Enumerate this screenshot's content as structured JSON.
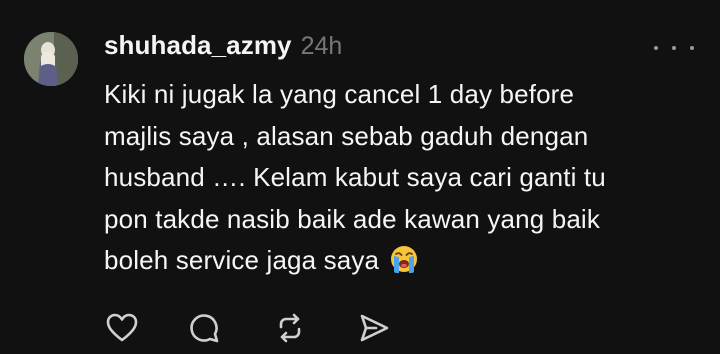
{
  "post": {
    "username": "shuhada_azmy",
    "time": "24h",
    "lines": [
      "Kiki ni jugak la yang cancel 1 day before",
      "majlis saya , alasan sebab gaduh dengan",
      "husband …. Kelam kabut saya cari ganti tu",
      "pon takde nasib baik ade kawan yang baik",
      "boleh service jaga saya"
    ],
    "emoji": "loudly-crying-face"
  },
  "actions": {
    "like_icon": "heart-icon",
    "comment_icon": "comment-bubble-icon",
    "repost_icon": "repost-icon",
    "share_icon": "send-icon"
  },
  "colors": {
    "background": "#111111",
    "text": "#f3f5f7",
    "muted": "#777777",
    "icon": "#cccccc"
  }
}
